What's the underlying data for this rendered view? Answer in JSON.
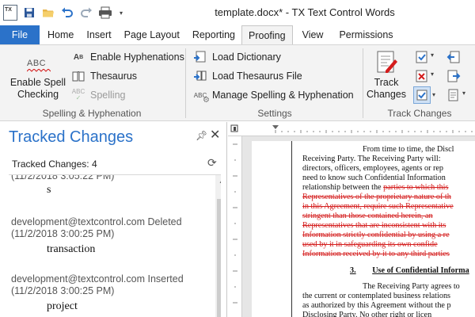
{
  "window": {
    "title": "template.docx* - TX Text Control Words",
    "app_logo_text": "TX"
  },
  "quick_access": [
    "save-icon",
    "open-folder-icon",
    "undo-icon",
    "redo-icon",
    "print-icon",
    "customize-dropdown-icon"
  ],
  "tabs": [
    {
      "label": "File"
    },
    {
      "label": "Home"
    },
    {
      "label": "Insert"
    },
    {
      "label": "Page Layout"
    },
    {
      "label": "Reporting"
    },
    {
      "label": "Proofing"
    },
    {
      "label": "View"
    },
    {
      "label": "Permissions"
    }
  ],
  "ribbon": {
    "spelling_group": {
      "label": "Spelling & Hyphenation",
      "enable_spell_line1": "Enable Spell",
      "enable_spell_line2": "Checking",
      "abc_icon_text": "ABC",
      "enable_hyphenations": "Enable Hyphenations",
      "thesaurus": "Thesaurus",
      "spelling": "Spelling"
    },
    "settings_group": {
      "label": "Settings",
      "load_dictionary": "Load Dictionary",
      "load_thesaurus": "Load Thesaurus File",
      "manage": "Manage Spelling & Hyphenation"
    },
    "track_group": {
      "label": "Track Changes",
      "track_line1": "Track",
      "track_line2": "Changes"
    }
  },
  "panel": {
    "title": "Tracked Changes",
    "count_label": "Tracked Changes: 4",
    "entries": [
      {
        "meta1": "",
        "meta2": "(11/2/2018 3:05:22 PM)",
        "word": "s"
      },
      {
        "meta1": "development@textcontrol.com Deleted",
        "meta2": "(11/2/2018 3:00:25 PM)",
        "word": "transaction"
      },
      {
        "meta1": "development@textcontrol.com Inserted",
        "meta2": "(11/2/2018 3:00:25 PM)",
        "word": "project"
      }
    ]
  },
  "document": {
    "lines": [
      {
        "text": "From time to time, the Discl",
        "indent": true,
        "deleted": false
      },
      {
        "text": "Receiving Party.  The Receiving Party will:",
        "deleted": false
      },
      {
        "text": "directors, officers, employees, agents or rep",
        "deleted": false
      },
      {
        "text": "need to know such Confidential Information",
        "deleted": false
      },
      {
        "text": "relationship between the ",
        "deleted_tail": "parties to which this",
        "deleted": false
      },
      {
        "text": "Representatives of the proprietary nature of th",
        "deleted": true
      },
      {
        "text": "in this Agreement, require such Representative",
        "deleted": true
      },
      {
        "text": "stringent than those contained herein, an",
        "deleted": true
      },
      {
        "text": "Representatives that are inconsistent with its",
        "deleted": true
      },
      {
        "text": "Information strictly confidential by using a re",
        "deleted": true
      },
      {
        "text": "used by it in safeguarding its own confide",
        "deleted": true
      },
      {
        "text": "Information received by it to any third parties",
        "deleted": true
      }
    ],
    "heading_number": "3.",
    "heading_text": "Use of Confidential Informa",
    "after_lines": [
      {
        "text": "The Receiving Party agrees to",
        "indent": true
      },
      {
        "text": "the current or contemplated business relations"
      },
      {
        "text": "as authorized by this Agreement without the p"
      },
      {
        "text": "Disclosing Party.  No other right or licen"
      }
    ]
  },
  "colors": {
    "accent": "#2b72c9",
    "tracked_deletion": "#d41c1c",
    "ribbon_bg": "#f3f3f3"
  }
}
